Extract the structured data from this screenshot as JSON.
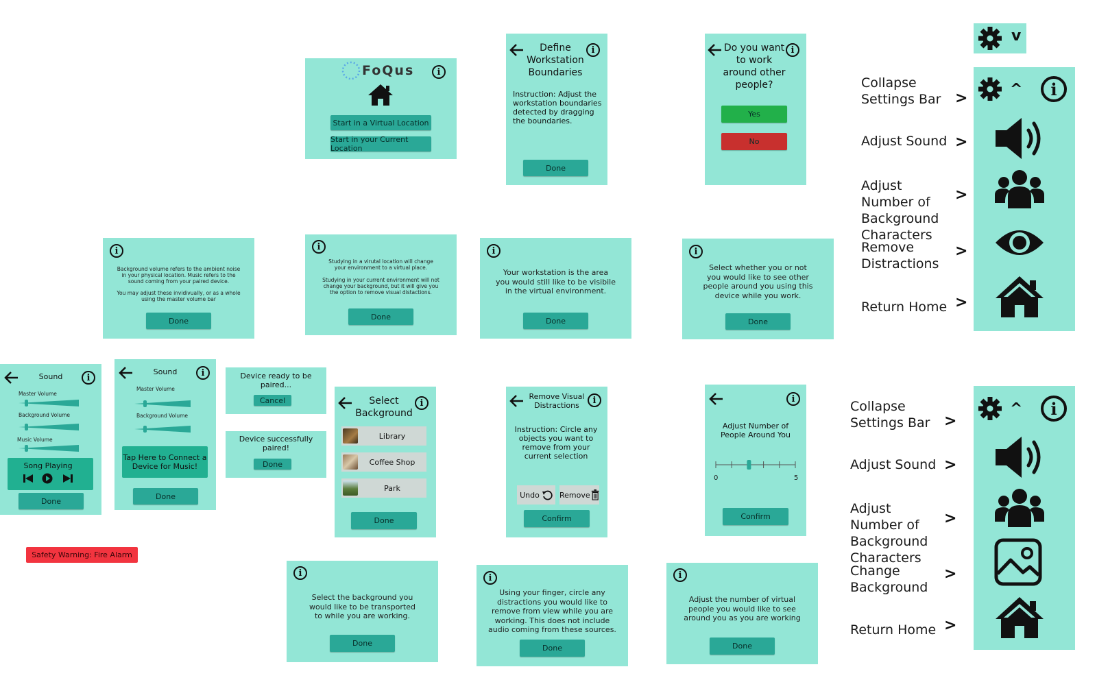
{
  "home": {
    "title": "FoQus",
    "start_virtual": "Start in a Virtual Location",
    "start_current": "Start in your Current Location"
  },
  "define": {
    "title": "Define Workstation Boundaries",
    "instruction": "Instruction: Adjust the workstation boundaries detected by dragging the boundaries.",
    "done": "Done"
  },
  "people_question": {
    "title": "Do you want to work around other people?",
    "yes": "Yes",
    "no": "No"
  },
  "info_sound": {
    "text1": "Background volume refers to the ambient noise in your physical location. Music refers to the sound coming from your paired device.",
    "text2": "You may adjust these invidivually, or as a whole using the master volume bar",
    "done": "Done"
  },
  "info_location": {
    "text1": "Studying in a virutal location will change your environment to a virtual place.",
    "text2": "Studying in your current environment will not change your background, but it will give you the option to remove visual distactions.",
    "done": "Done"
  },
  "info_workstation": {
    "text": "Your workstation is the area you would still like to be visibile in the virtual environment.",
    "done": "Done"
  },
  "info_people": {
    "text": "Select whether you or not you would like to see other people around you using this device while you work.",
    "done": "Done"
  },
  "sound1": {
    "title": "Sound",
    "master": "Master Volume",
    "background": "Background Volume",
    "music": "Music Volume",
    "song": "Song Playing",
    "done": "Done"
  },
  "sound2": {
    "title": "Sound",
    "master": "Master Volume",
    "background": "Background Volume",
    "connect": "Tap Here to Connect a Device for Music!",
    "done": "Done"
  },
  "pairing": {
    "ready": "Device ready to be paired...",
    "cancel": "Cancel",
    "success": "Device successfully paired!",
    "done": "Done"
  },
  "select_bg": {
    "title": "Select Background",
    "options": [
      "Library",
      "Coffee Shop",
      "Park"
    ],
    "done": "Done"
  },
  "remove": {
    "title": "Remove Visual Distractions",
    "instruction": "Instruction: Circle any objects you want to remove from your current selection",
    "undo": "Undo",
    "remove": "Remove",
    "confirm": "Confirm"
  },
  "adjust_people": {
    "title": "Adjust Number of People Around You",
    "min": "0",
    "max": "5",
    "value": 2,
    "confirm": "Confirm"
  },
  "safety": "Safety Warning: Fire Alarm",
  "info_bg": {
    "text": "Select the background you would like to be transported to while you are working.",
    "done": "Done"
  },
  "info_distractions": {
    "text": "Using your finger, circle any distractions you would like to remove from view while you are working. This does not include audio coming from these sources.",
    "done": "Done"
  },
  "info_adjust": {
    "text": "Adjust the number of virtual people you would like to see around you as you are working",
    "done": "Done"
  },
  "collapsed_bar": {
    "chevron": "v"
  },
  "settings1": {
    "labels": [
      "Collapse Settings Bar",
      "Adjust Sound",
      "Adjust Number of Background Characters",
      "Remove Distractions",
      "Return Home"
    ],
    "arrow": ">",
    "chevron": "^"
  },
  "settings2": {
    "labels": [
      "Collapse Settings Bar",
      "Adjust Sound",
      "Adjust Number of Background Characters",
      "Change Background",
      "Return Home"
    ],
    "arrow": ">",
    "chevron": "^"
  },
  "info_glyph": "i",
  "colors": {
    "card": "#93e6d6",
    "button": "#2aa897",
    "yes": "#22b04a",
    "no": "#c8302e",
    "warning": "#f2343f",
    "list": "#cfd8d5"
  }
}
